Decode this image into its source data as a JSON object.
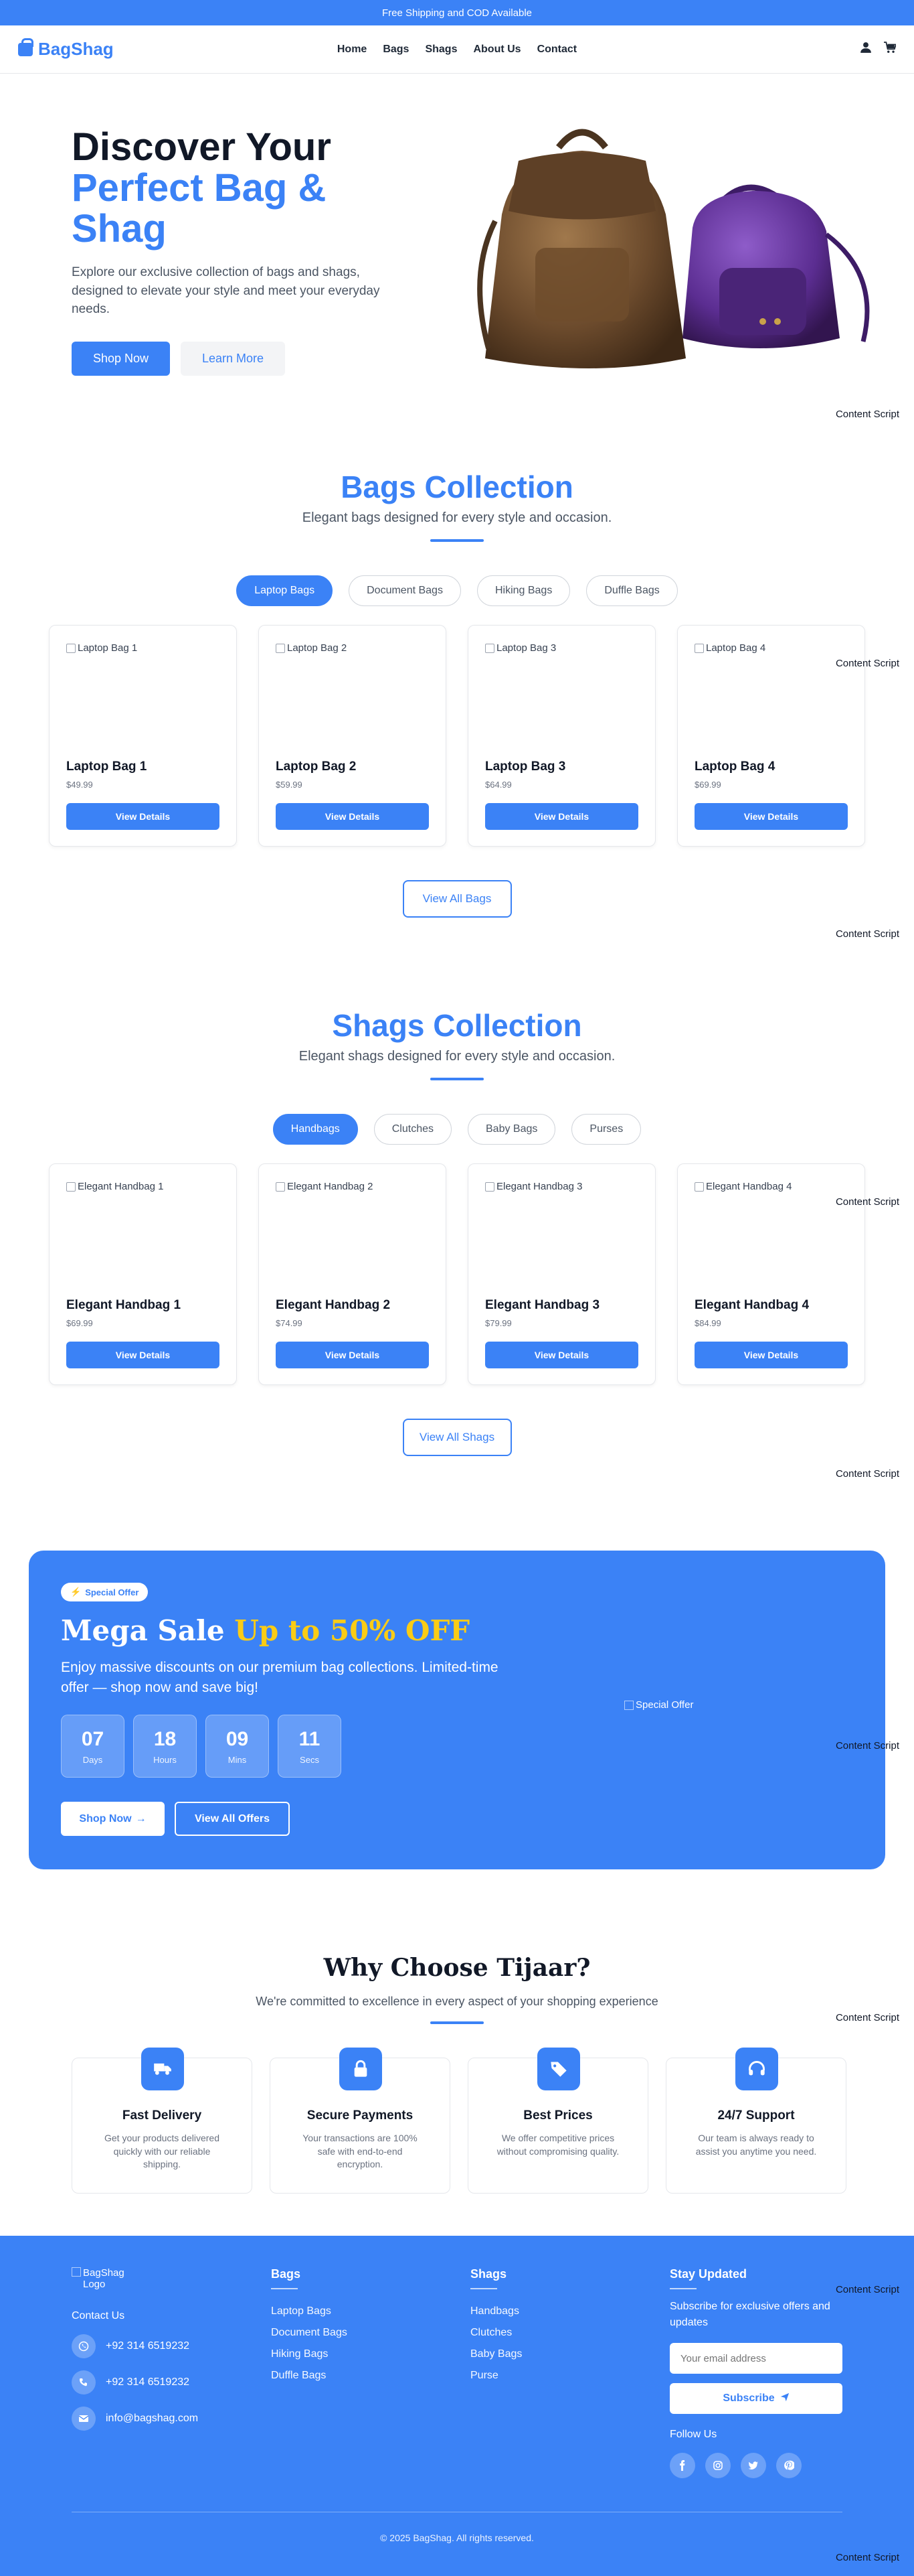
{
  "topbar": {
    "text": "Free Shipping and COD Available"
  },
  "brand": {
    "name": "BagShag",
    "color": "#3b82f6"
  },
  "nav": {
    "links": [
      "Home",
      "Bags",
      "Shags",
      "About Us",
      "Contact"
    ],
    "icons": [
      "user-icon",
      "cart-icon"
    ]
  },
  "hero": {
    "title_line1": "Discover Your",
    "title_line2": "Perfect Bag &",
    "title_line3": "Shag",
    "description": "Explore our exclusive collection of bags and shags, designed to elevate your style and meet your everyday needs.",
    "primary_button": "Shop Now",
    "secondary_button": "Learn More"
  },
  "content_script_label": "Content Script",
  "bags": {
    "title": "Bags Collection",
    "subtitle": "Elegant bags designed for every style and occasion.",
    "tabs": [
      "Laptop Bags",
      "Document Bags",
      "Hiking Bags",
      "Duffle Bags"
    ],
    "active_tab": "Laptop Bags",
    "products": [
      {
        "alt": "Laptop Bag 1",
        "name": "Laptop Bag 1",
        "price": "$49.99"
      },
      {
        "alt": "Laptop Bag 2",
        "name": "Laptop Bag 2",
        "price": "$59.99"
      },
      {
        "alt": "Laptop Bag 3",
        "name": "Laptop Bag 3",
        "price": "$64.99"
      },
      {
        "alt": "Laptop Bag 4",
        "name": "Laptop Bag 4",
        "price": "$69.99"
      }
    ],
    "details_label": "View Details",
    "view_all": "View All Bags"
  },
  "shags": {
    "title": "Shags Collection",
    "subtitle": "Elegant shags designed for every style and occasion.",
    "tabs": [
      "Handbags",
      "Clutches",
      "Baby Bags",
      "Purses"
    ],
    "active_tab": "Handbags",
    "products": [
      {
        "alt": "Elegant Handbag 1",
        "name": "Elegant Handbag 1",
        "price": "$69.99"
      },
      {
        "alt": "Elegant Handbag 2",
        "name": "Elegant Handbag 2",
        "price": "$74.99"
      },
      {
        "alt": "Elegant Handbag 3",
        "name": "Elegant Handbag 3",
        "price": "$79.99"
      },
      {
        "alt": "Elegant Handbag 4",
        "name": "Elegant Handbag 4",
        "price": "$84.99"
      }
    ],
    "details_label": "View Details",
    "view_all": "View All Shags"
  },
  "promo": {
    "badge": "Special Offer",
    "title": "Mega Sale",
    "highlight": "Up to 50% OFF",
    "highlight_color": "#facc15",
    "description": "Enjoy massive discounts on our premium bag collections. Limited-time offer — shop now and save big!",
    "countdown": [
      {
        "value": "07",
        "label": "Days"
      },
      {
        "value": "18",
        "label": "Hours"
      },
      {
        "value": "09",
        "label": "Mins"
      },
      {
        "value": "11",
        "label": "Secs"
      }
    ],
    "shop_button": "Shop Now",
    "all_offers_button": "View All Offers",
    "image_alt": "Special Offer"
  },
  "why": {
    "title": "Why Choose Tijaar?",
    "subtitle": "We're committed to excellence in every aspect of your shopping experience",
    "features": [
      {
        "icon": "truck-icon",
        "title": "Fast Delivery",
        "desc": "Get your products delivered quickly with our reliable shipping."
      },
      {
        "icon": "lock-icon",
        "title": "Secure Payments",
        "desc": "Your transactions are 100% safe with end-to-end encryption."
      },
      {
        "icon": "tags-icon",
        "title": "Best Prices",
        "desc": "We offer competitive prices without compromising quality."
      },
      {
        "icon": "headset-icon",
        "title": "24/7 Support",
        "desc": "Our team is always ready to assist you anytime you need."
      }
    ]
  },
  "footer": {
    "logo_alt": "BagShag Logo",
    "contact_label": "Contact Us",
    "phones": [
      "+92 314 6519232",
      "+92 314 6519232"
    ],
    "email": "info@bagshag.com",
    "bags_head": "Bags",
    "bags_links": [
      "Laptop Bags",
      "Document Bags",
      "Hiking Bags",
      "Duffle Bags"
    ],
    "shags_head": "Shags",
    "shags_links": [
      "Handbags",
      "Clutches",
      "Baby Bags",
      "Purse"
    ],
    "newsletter_head": "Stay Updated",
    "newsletter_text": "Subscribe for exclusive offers and updates",
    "email_placeholder": "Your email address",
    "subscribe": "Subscribe",
    "follow": "Follow Us",
    "socials": [
      "facebook-icon",
      "instagram-icon",
      "twitter-icon",
      "pinterest-icon"
    ],
    "copyright": "© 2025 BagShag. All rights reserved."
  }
}
